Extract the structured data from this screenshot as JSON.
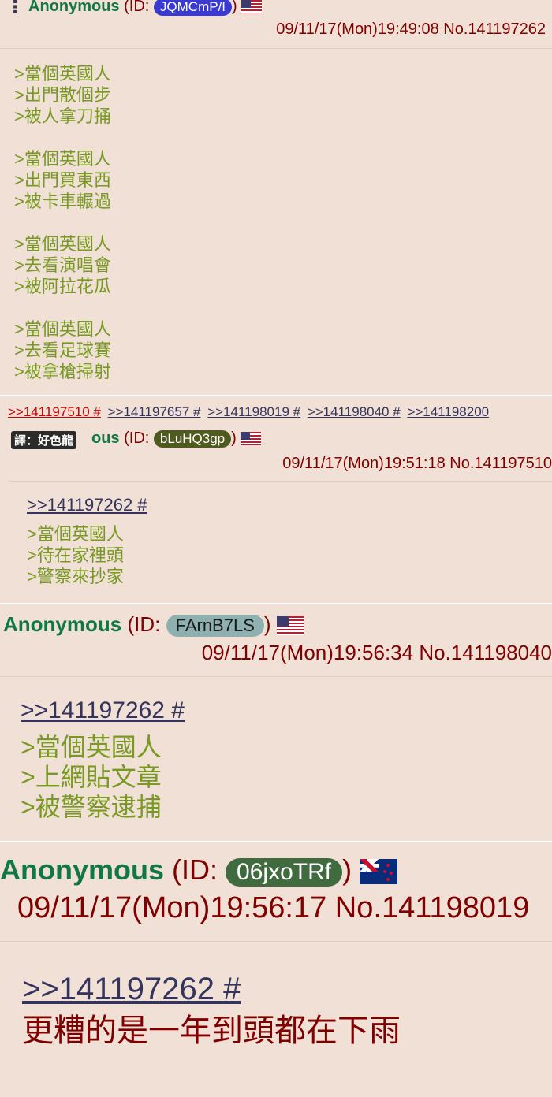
{
  "post1": {
    "dots": "⋮",
    "name": "Anonymous",
    "id_prefix": "(ID:",
    "id": "JQMCmP/I",
    "id_suffix": ")",
    "id_color": "#3a3ad0",
    "flag": "us-flag-icon",
    "date": "09/11/17(Mon)19:49:08 No.141197262",
    "lines": [
      ">當個英國人",
      ">出門散個步",
      ">被人拿刀捅",
      ">當個英國人",
      ">出門買東西",
      ">被卡車輾過",
      ">當個英國人",
      ">去看演唱會",
      ">被阿拉花瓜",
      ">當個英國人",
      ">去看足球賽",
      ">被拿槍掃射"
    ],
    "backlinks": [
      ">>141197510 #",
      ">>141197657 #",
      ">>141198019 #",
      ">>141198040 #",
      ">>141198200"
    ]
  },
  "post2": {
    "translator_badge": "譯：好色龍",
    "name_tail": "ous",
    "id_prefix": "(ID:",
    "id": "bLuHQ3gp",
    "id_suffix": ")",
    "id_color": "#4f5a1f",
    "flag": "us-flag-icon",
    "date": "09/11/17(Mon)19:51:18 No.141197510",
    "quote": ">>141197262 #",
    "lines": [
      ">當個英國人",
      ">待在家裡頭",
      ">警察來抄家"
    ]
  },
  "post3": {
    "name": "Anonymous",
    "id_prefix": "(ID:",
    "id": "FArnB7LS",
    "id_suffix": ")",
    "id_color": "#8fb0b0",
    "flag": "us-flag-icon",
    "date": "09/11/17(Mon)19:56:34 No.141198040",
    "quote": ">>141197262 #",
    "lines": [
      ">當個英國人",
      ">上網貼文章",
      ">被警察逮捕"
    ]
  },
  "post4": {
    "name": "Anonymous",
    "id_prefix": "(ID:",
    "id": "06jxoTRf",
    "id_suffix": ")",
    "id_color": "#3f6b3f",
    "flag": "nz-flag-icon",
    "date": "09/11/17(Mon)19:56:17 No.141198019",
    "quote": ">>141197262 #",
    "text": "更糟的是一年到頭都在下雨"
  }
}
